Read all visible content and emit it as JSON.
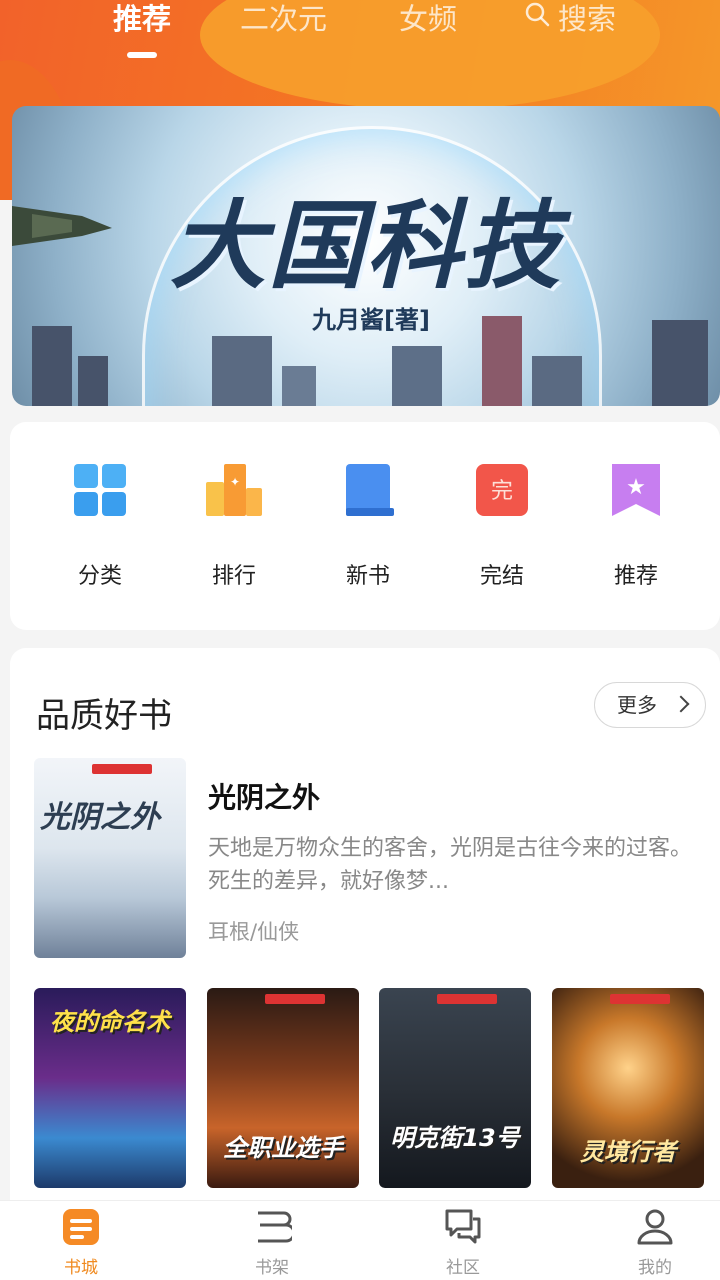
{
  "top_tabs": [
    {
      "label": "推荐",
      "active": true
    },
    {
      "label": "二次元",
      "active": false
    },
    {
      "label": "女频",
      "active": false
    },
    {
      "label": "搜索",
      "active": false,
      "icon": "search-icon"
    }
  ],
  "banner": {
    "title": "大国科技",
    "author": "九月酱[著]"
  },
  "quick_nav": [
    {
      "label": "分类",
      "icon": "grid-icon",
      "color": "#3aa0ee"
    },
    {
      "label": "排行",
      "icon": "podium-icon",
      "color": "#f7a53a"
    },
    {
      "label": "新书",
      "icon": "book-icon",
      "color": "#4a8ff0"
    },
    {
      "label": "完结",
      "icon": "complete-stamp-icon",
      "color": "#f2564a"
    },
    {
      "label": "推荐",
      "icon": "bookmark-star-icon",
      "color": "#c77ef0"
    }
  ],
  "quality_section": {
    "title": "品质好书",
    "more_label": "更多",
    "featured": {
      "cover_title": "光阴之外",
      "name": "光阴之外",
      "description": "天地是万物众生的客舍，光阴是古往今来的过客。 死生的差异，就好像梦...",
      "meta": "耳根/仙侠"
    },
    "grid": [
      {
        "cover_title": "夜的命名术"
      },
      {
        "cover_title": "全职业选手"
      },
      {
        "cover_title": "明克街13号"
      },
      {
        "cover_title": "灵境行者"
      }
    ]
  },
  "bottom_nav": [
    {
      "label": "书城",
      "icon": "bookstore-icon",
      "active": true
    },
    {
      "label": "书架",
      "icon": "bookshelf-icon",
      "active": false
    },
    {
      "label": "社区",
      "icon": "chat-bubbles-icon",
      "active": false
    },
    {
      "label": "我的",
      "icon": "user-icon",
      "active": false
    }
  ],
  "colors": {
    "accent": "#f08a1f",
    "header_orange": "#f47a22"
  }
}
